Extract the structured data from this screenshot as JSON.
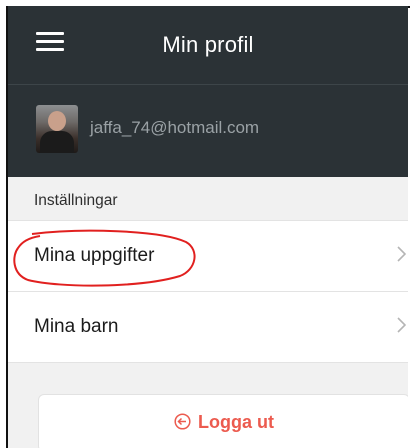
{
  "header": {
    "title": "Min profil",
    "menu_icon": "hamburger-menu-icon"
  },
  "profile": {
    "email": "jaffa_74@hotmail.com",
    "avatar_icon": "user-avatar"
  },
  "settings": {
    "section_label": "Inställningar",
    "items": [
      {
        "label": "Mina uppgifter",
        "icon": "chevron-right-icon",
        "highlighted": true
      },
      {
        "label": "Mina barn",
        "icon": "chevron-right-icon"
      }
    ]
  },
  "logout": {
    "label": "Logga ut",
    "icon": "logout-icon"
  },
  "colors": {
    "header_bg": "#2b3236",
    "accent": "#ec5b4f",
    "annotation": "#e1201f",
    "page_bg": "#f1f1f1"
  }
}
